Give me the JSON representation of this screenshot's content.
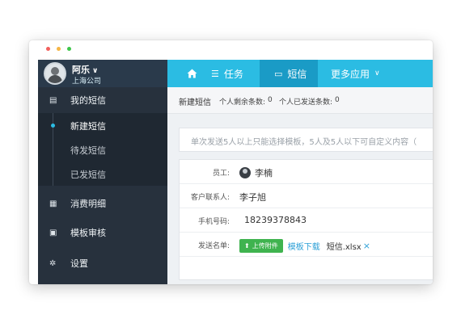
{
  "window": {
    "dot_colors": [
      "#f2605c",
      "#f6b544",
      "#3ec64a"
    ]
  },
  "user": {
    "name": "阿乐",
    "company": "上海公司"
  },
  "nav": {
    "home_icon": "home-icon",
    "items": [
      {
        "label": "任务",
        "icon": "list-icon"
      },
      {
        "label": "短信",
        "icon": "message-icon"
      },
      {
        "label": "更多应用",
        "icon": "chevron-down-icon"
      }
    ]
  },
  "sidebar": {
    "my_sms": "我的短信",
    "sub_items": [
      "新建短信",
      "待发短信",
      "已发短信"
    ],
    "consumption": "消费明细",
    "template_review": "模板审核",
    "settings": "设置"
  },
  "breadcrumb": {
    "title": "新建短信",
    "personal_remaining_label": "个人剩余条数:",
    "personal_remaining_value": "0",
    "personal_sent_label": "个人已发送条数:",
    "personal_sent_value": "0"
  },
  "notice": "单次发送5人以上只能选择模板，5人及5人以下可自定义内容（",
  "form": {
    "employee_label": "员工:",
    "employee_value": "李楠",
    "contact_label": "客户联系人:",
    "contact_value": "李子旭",
    "phone_label": "手机号码:",
    "phone_value": "18239378843",
    "list_label": "发送名单:",
    "upload_label": "上传附件",
    "template_download": "模板下载",
    "file_name": "短信.xlsx",
    "remove_symbol": "×"
  },
  "colors": {
    "accent": "#2bbce3",
    "nav_active": "#1a9bc6",
    "sidebar_bg": "#27313d",
    "upload_green": "#3fb34f"
  }
}
